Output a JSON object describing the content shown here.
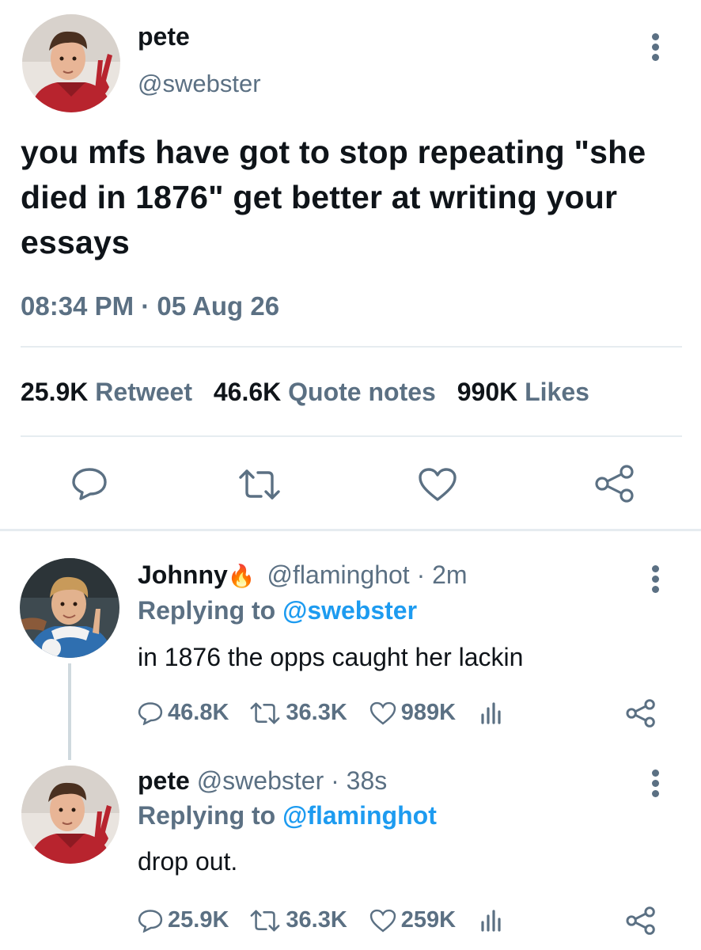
{
  "tweet": {
    "name": "pete",
    "handle": "@swebster",
    "text": "you mfs have got to stop repeating \"she died in 1876\" get better at writing your essays",
    "timestamp": "08:34 PM · 05 Aug 26",
    "stats": [
      {
        "count": "25.9K",
        "label": "Retweet"
      },
      {
        "count": "46.6K",
        "label": "Quote notes"
      },
      {
        "count": "990K",
        "label": "Likes"
      }
    ],
    "actions": [
      "reply-icon",
      "retweet-icon",
      "like-icon",
      "share-icon"
    ]
  },
  "replies": [
    {
      "name": "Johnny",
      "emoji": "🔥",
      "handle_time": "@flaminghot · 2m",
      "replying_prefix": "Replying to",
      "replying_handle": "@swebster",
      "text": "in 1876 the opps caught her lackin",
      "replies": "46.8K",
      "retweets": "36.3K",
      "likes": "989K"
    },
    {
      "name": "pete",
      "handle_time": "@swebster · 38s",
      "replying_prefix": "Replying to",
      "replying_handle": "@flaminghot",
      "text": "drop out.",
      "replies": "25.9K",
      "retweets": "36.3K",
      "likes": "259K"
    }
  ],
  "colors": {
    "accent": "#1d9bf0",
    "secondary": "#5b7083",
    "divider": "#e6ecf0"
  }
}
